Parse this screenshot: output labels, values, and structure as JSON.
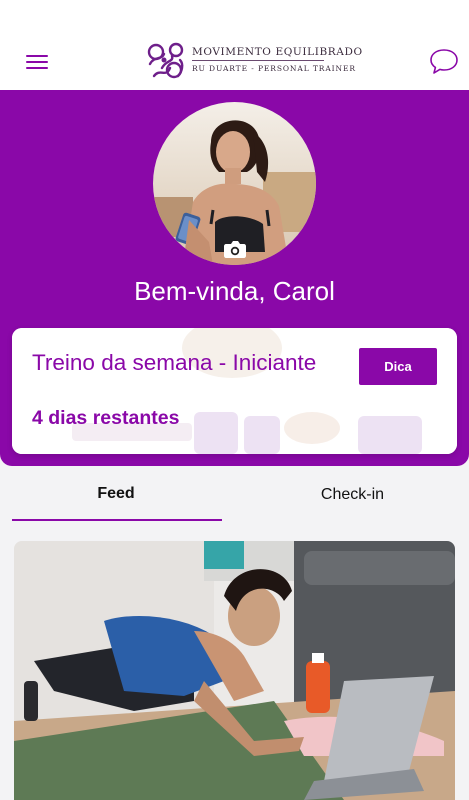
{
  "header": {
    "logo": {
      "title": "MOVIMENTO EQUILIBRADO",
      "subtitle": "RU DUARTE - PERSONAL TRAINER"
    },
    "menu_icon": "hamburger-menu-icon",
    "chat_icon": "chat-bubbles-icon"
  },
  "profile": {
    "welcome": "Bem-vinda, Carol",
    "camera_icon": "camera-icon"
  },
  "week_card": {
    "title": "Treino da semana - Iniciante",
    "tip_label": "Dica",
    "days_left": "4 dias restantes"
  },
  "tabs": [
    {
      "label": "Feed",
      "active": true
    },
    {
      "label": "Check-in",
      "active": false
    }
  ],
  "colors": {
    "brand": "#8a08a8",
    "background": "#f3f3f5",
    "card": "#ffffff"
  }
}
